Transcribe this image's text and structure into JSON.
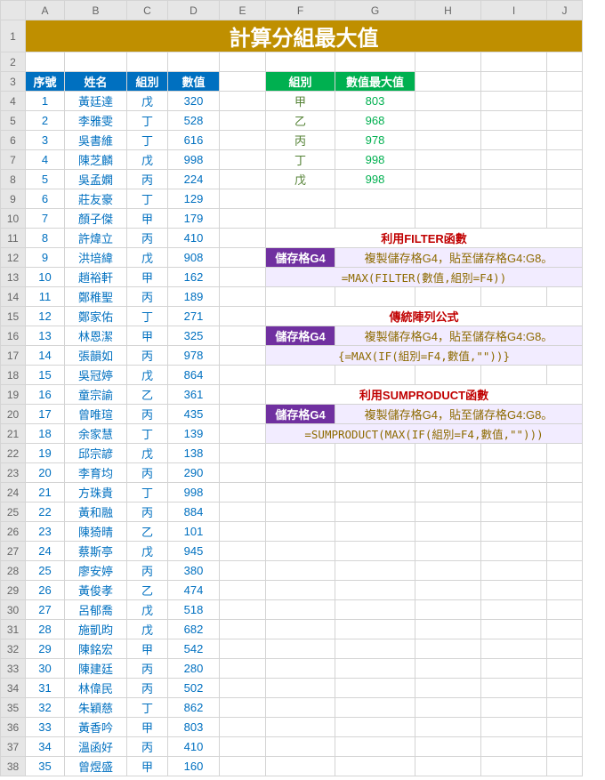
{
  "columns": [
    "A",
    "B",
    "C",
    "D",
    "E",
    "F",
    "G",
    "H",
    "I",
    "J"
  ],
  "title": "計算分組最大值",
  "table_headers": {
    "seq": "序號",
    "name": "姓名",
    "group": "組別",
    "value": "數值"
  },
  "result_headers": {
    "group": "組別",
    "max": "數值最大值"
  },
  "rows": [
    {
      "n": 1,
      "name": "黃廷達",
      "g": "戊",
      "v": 320
    },
    {
      "n": 2,
      "name": "李雅雯",
      "g": "丁",
      "v": 528
    },
    {
      "n": 3,
      "name": "吳書維",
      "g": "丁",
      "v": 616
    },
    {
      "n": 4,
      "name": "陳芝麟",
      "g": "戊",
      "v": 998
    },
    {
      "n": 5,
      "name": "吳孟嫻",
      "g": "丙",
      "v": 224
    },
    {
      "n": 6,
      "name": "莊友豪",
      "g": "丁",
      "v": 129
    },
    {
      "n": 7,
      "name": "顏子傑",
      "g": "甲",
      "v": 179
    },
    {
      "n": 8,
      "name": "許煒立",
      "g": "丙",
      "v": 410
    },
    {
      "n": 9,
      "name": "洪培緯",
      "g": "戊",
      "v": 908
    },
    {
      "n": 10,
      "name": "趙裕軒",
      "g": "甲",
      "v": 162
    },
    {
      "n": 11,
      "name": "鄭稚聖",
      "g": "丙",
      "v": 189
    },
    {
      "n": 12,
      "name": "鄭家佑",
      "g": "丁",
      "v": 271
    },
    {
      "n": 13,
      "name": "林恩潔",
      "g": "甲",
      "v": 325
    },
    {
      "n": 14,
      "name": "張韻如",
      "g": "丙",
      "v": 978
    },
    {
      "n": 15,
      "name": "吳冠婷",
      "g": "戊",
      "v": 864
    },
    {
      "n": 16,
      "name": "童宗諭",
      "g": "乙",
      "v": 361
    },
    {
      "n": 17,
      "name": "曾唯瑄",
      "g": "丙",
      "v": 435
    },
    {
      "n": 18,
      "name": "余家慧",
      "g": "丁",
      "v": 139
    },
    {
      "n": 19,
      "name": "邱宗諺",
      "g": "戊",
      "v": 138
    },
    {
      "n": 20,
      "name": "李育均",
      "g": "丙",
      "v": 290
    },
    {
      "n": 21,
      "name": "方珠貴",
      "g": "丁",
      "v": 998
    },
    {
      "n": 22,
      "name": "黃和融",
      "g": "丙",
      "v": 884
    },
    {
      "n": 23,
      "name": "陳猗晴",
      "g": "乙",
      "v": 101
    },
    {
      "n": 24,
      "name": "蔡斯亭",
      "g": "戊",
      "v": 945
    },
    {
      "n": 25,
      "name": "廖安婷",
      "g": "丙",
      "v": 380
    },
    {
      "n": 26,
      "name": "黃俊孝",
      "g": "乙",
      "v": 474
    },
    {
      "n": 27,
      "name": "呂郁喬",
      "g": "戊",
      "v": 518
    },
    {
      "n": 28,
      "name": "施凱昀",
      "g": "戊",
      "v": 682
    },
    {
      "n": 29,
      "name": "陳銘宏",
      "g": "甲",
      "v": 542
    },
    {
      "n": 30,
      "name": "陳建廷",
      "g": "丙",
      "v": 280
    },
    {
      "n": 31,
      "name": "林偉民",
      "g": "丙",
      "v": 502
    },
    {
      "n": 32,
      "name": "朱穎慈",
      "g": "丁",
      "v": 862
    },
    {
      "n": 33,
      "name": "黃香吟",
      "g": "甲",
      "v": 803
    },
    {
      "n": 34,
      "name": "溫函好",
      "g": "丙",
      "v": 410
    },
    {
      "n": 35,
      "name": "曾煜盛",
      "g": "甲",
      "v": 160
    }
  ],
  "results": [
    {
      "g": "甲",
      "v": 803
    },
    {
      "g": "乙",
      "v": 968
    },
    {
      "g": "丙",
      "v": 978
    },
    {
      "g": "丁",
      "v": 998
    },
    {
      "g": "戊",
      "v": 998
    }
  ],
  "sections": [
    {
      "label": "利用FILTER函數",
      "badge": "儲存格G4",
      "note": "複製儲存格G4，貼至儲存格G4:G8。",
      "formula": "=MAX(FILTER(數值,組別=F4))"
    },
    {
      "label": "傳統陣列公式",
      "badge": "儲存格G4",
      "note": "複製儲存格G4，貼至儲存格G4:G8。",
      "formula": "{=MAX(IF(組別=F4,數值,\"\"))}"
    },
    {
      "label": "利用SUMPRODUCT函數",
      "badge": "儲存格G4",
      "note": "複製儲存格G4，貼至儲存格G4:G8。",
      "formula": "=SUMPRODUCT(MAX(IF(組別=F4,數值,\"\")))"
    }
  ]
}
